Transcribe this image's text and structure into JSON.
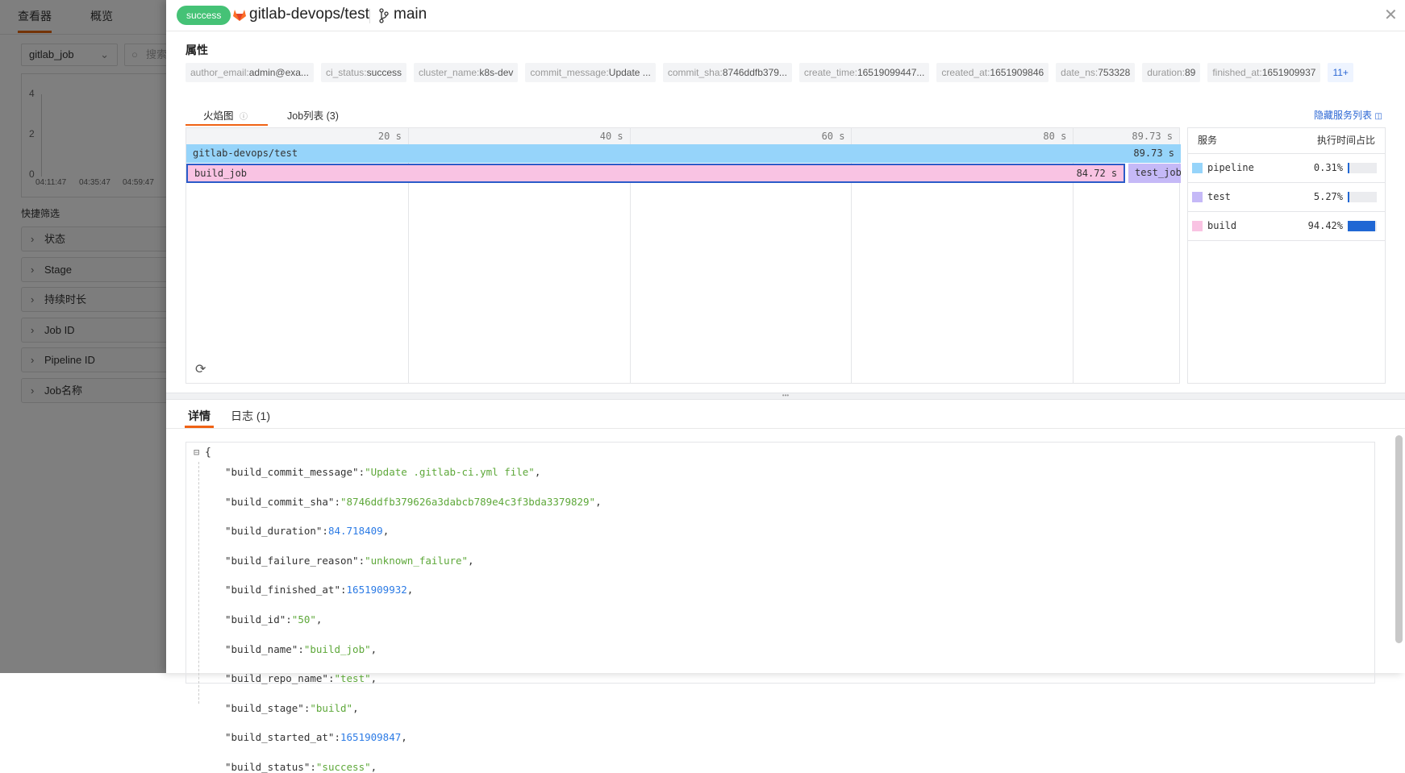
{
  "left_page": {
    "tabs": [
      "查看器",
      "概览"
    ],
    "source_select": "gitlab_job",
    "search_placeholder": "搜索",
    "mini_chart": {
      "y_ticks": [
        "4",
        "2",
        "0"
      ],
      "x_ticks": [
        "04:11:47",
        "04:35:47",
        "04:59:47"
      ]
    },
    "quick_filter_title": "快捷筛选",
    "filters": [
      "状态",
      "Stage",
      "持续时长",
      "Job ID",
      "Pipeline ID",
      "Job名称"
    ]
  },
  "drawer": {
    "status_badge": "success",
    "status_color": "#45c276",
    "repo": "gitlab-devops/test",
    "branch": "main",
    "attributes_title": "属性",
    "attributes": [
      {
        "k": "author_email:",
        "v": "admin@exa..."
      },
      {
        "k": "ci_status:",
        "v": "success"
      },
      {
        "k": "cluster_name:",
        "v": "k8s-dev"
      },
      {
        "k": "commit_message:",
        "v": "Update ..."
      },
      {
        "k": "commit_sha:",
        "v": "8746ddfb379..."
      },
      {
        "k": "create_time:",
        "v": "16519099447..."
      },
      {
        "k": "created_at:",
        "v": "1651909846"
      },
      {
        "k": "date_ns:",
        "v": "753328"
      },
      {
        "k": "duration:",
        "v": "89"
      },
      {
        "k": "finished_at:",
        "v": "1651909937"
      }
    ],
    "more_attributes": "11+",
    "tabs": [
      {
        "label": "火焰图",
        "active": true
      },
      {
        "label": "Job列表 (3)",
        "active": false
      }
    ],
    "hide_services": "隐藏服务列表",
    "flame": {
      "ticks": [
        "20 s",
        "40 s",
        "60 s",
        "80 s",
        "89.73 s"
      ],
      "spans": [
        {
          "name": "gitlab-devops/test",
          "duration": "89.73 s",
          "start": 0,
          "end": 89.73,
          "service": "pipeline"
        },
        {
          "name": "build_job",
          "duration": "84.72 s",
          "start": 0,
          "end": 84.72,
          "service": "build"
        },
        {
          "name": "test_job",
          "duration": "",
          "start": 85.0,
          "end": 89.73,
          "service": "test"
        }
      ]
    },
    "services": {
      "header": [
        "服务",
        "执行时间占比"
      ],
      "rows": [
        {
          "name": "pipeline",
          "pct": "0.31%",
          "value": 0.31,
          "color": "#96d4fa"
        },
        {
          "name": "test",
          "pct": "5.27%",
          "value": 5.27,
          "color": "#c5b9f7"
        },
        {
          "name": "build",
          "pct": "94.42%",
          "value": 94.42,
          "color": "#f9c3e3"
        }
      ],
      "bar_color": "#2067d4"
    },
    "bottom_tabs": [
      {
        "label": "详情",
        "active": true
      },
      {
        "label": "日志 (1)",
        "active": false
      }
    ],
    "json": [
      {
        "k": "\"build_commit_message\"",
        "v": "\"Update .gitlab-ci.yml file\"",
        "t": "s"
      },
      {
        "k": "\"build_commit_sha\"",
        "v": "\"8746ddfb379626a3dabcb789e4c3f3bda3379829\"",
        "t": "s"
      },
      {
        "k": "\"build_duration\"",
        "v": "84.718409",
        "t": "n"
      },
      {
        "k": "\"build_failure_reason\"",
        "v": "\"unknown_failure\"",
        "t": "s"
      },
      {
        "k": "\"build_finished_at\"",
        "v": "1651909932",
        "t": "n"
      },
      {
        "k": "\"build_id\"",
        "v": "\"50\"",
        "t": "s"
      },
      {
        "k": "\"build_name\"",
        "v": "\"build_job\"",
        "t": "s"
      },
      {
        "k": "\"build_repo_name\"",
        "v": "\"test\"",
        "t": "s"
      },
      {
        "k": "\"build_stage\"",
        "v": "\"build\"",
        "t": "s"
      },
      {
        "k": "\"build_started_at\"",
        "v": "1651909847",
        "t": "n"
      },
      {
        "k": "\"build_status\"",
        "v": "\"success\"",
        "t": "s"
      }
    ]
  }
}
